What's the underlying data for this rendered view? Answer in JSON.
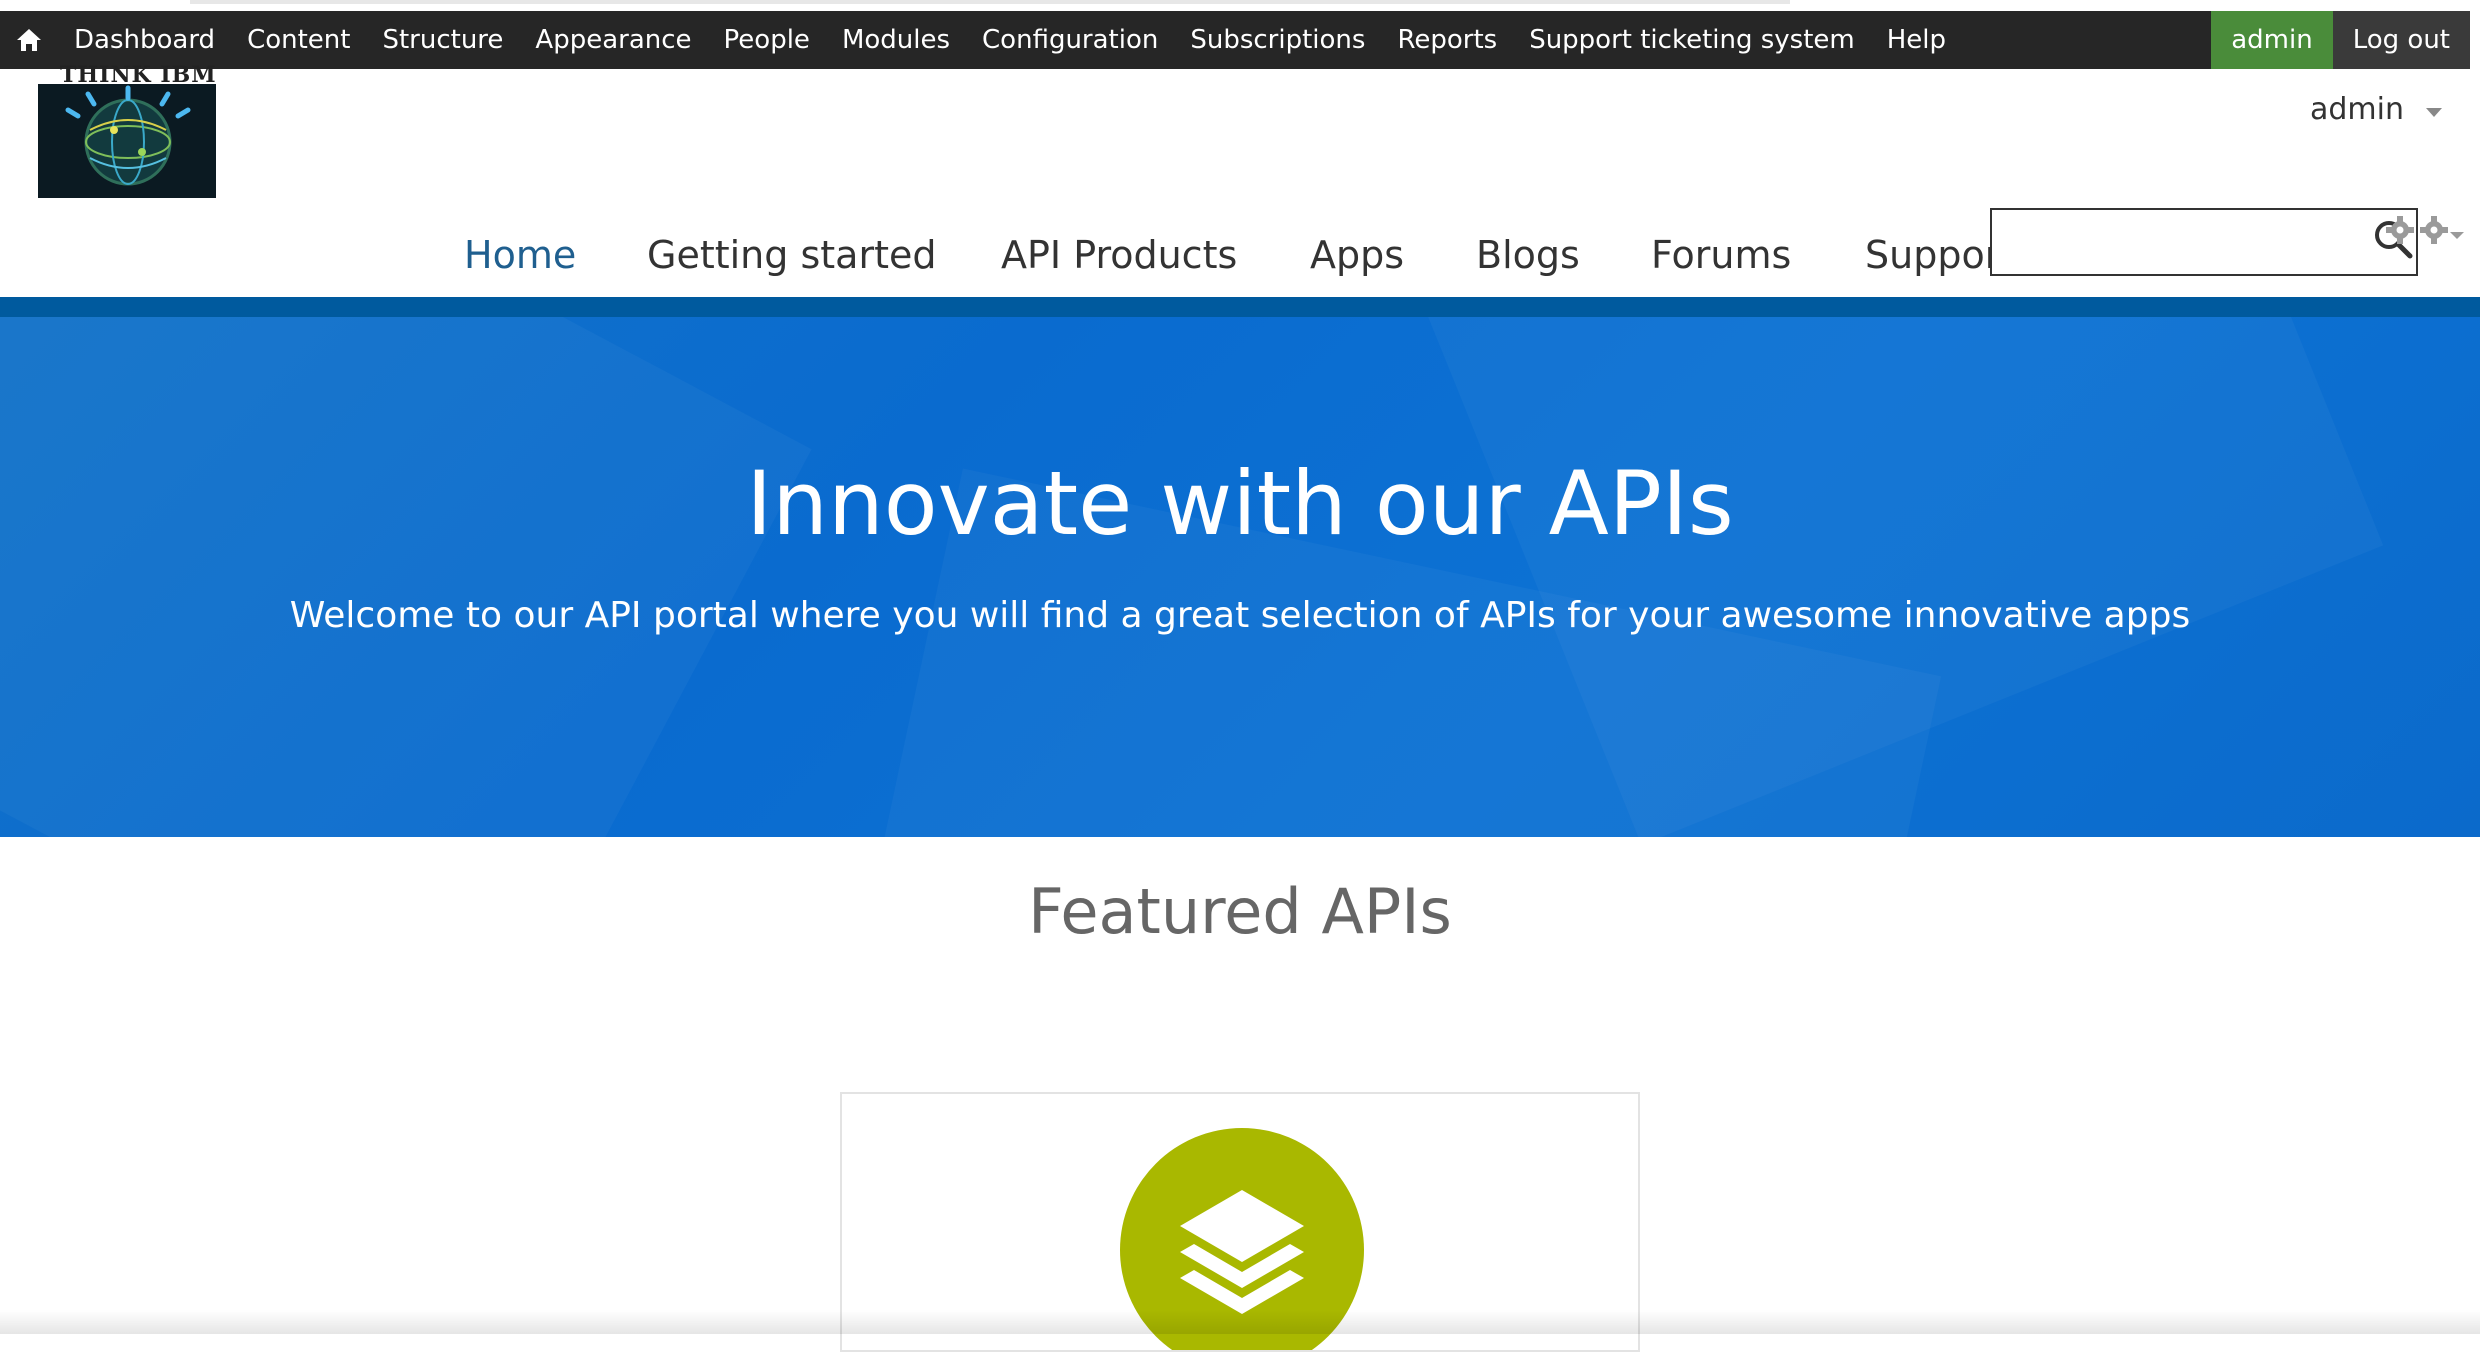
{
  "toolbar": {
    "items": [
      "Dashboard",
      "Content",
      "Structure",
      "Appearance",
      "People",
      "Modules",
      "Configuration",
      "Subscriptions",
      "Reports",
      "Support ticketing system",
      "Help"
    ],
    "user": "admin",
    "logout": "Log out"
  },
  "logo": {
    "text": "THINK IBM"
  },
  "user_menu": {
    "label": "admin"
  },
  "nav": {
    "items": [
      "Home",
      "Getting started",
      "API Products",
      "Apps",
      "Blogs",
      "Forums",
      "Support"
    ],
    "active": "Home"
  },
  "search": {
    "placeholder": ""
  },
  "hero": {
    "title": "Innovate with our APIs",
    "subtitle": "Welcome to our API portal where you will find a great selection of APIs for your awesome innovative apps"
  },
  "featured": {
    "heading": "Featured APIs"
  },
  "colors": {
    "toolbar_bg": "#262626",
    "admin_bg": "#4a8c3a",
    "hero_bg": "#0a6bcf",
    "nav_active": "#1f5f8f",
    "api_icon": "#a9b800"
  },
  "icons": [
    "home-icon",
    "logo-globe-icon",
    "chevron-down-icon",
    "search-icon",
    "gear-icon",
    "layers-icon"
  ]
}
